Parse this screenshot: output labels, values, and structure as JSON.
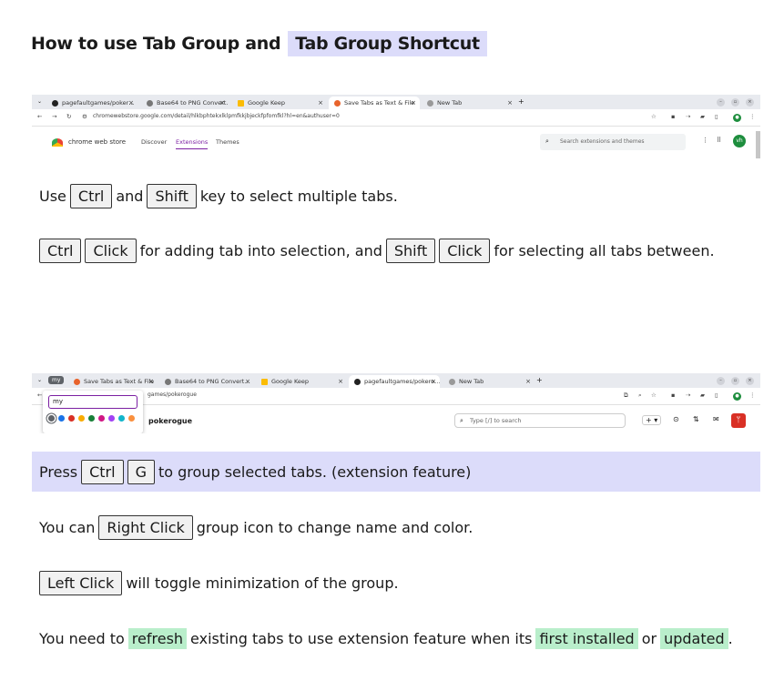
{
  "title": {
    "prefix": "How to use Tab Group and",
    "highlight": "Tab Group Shortcut"
  },
  "shot1": {
    "tabs": [
      "pagefaultgames/poker…",
      "Base64 to PNG Convert…",
      "Google Keep",
      "Save Tabs as Text & File",
      "New Tab"
    ],
    "url": "chromewebstore.google.com/detail/hlkbphtekxlklpmfkkjbjeckfpfomfkl?hl=en&authuser=0",
    "store_name": "chrome web store",
    "nav": [
      "Discover",
      "Extensions",
      "Themes"
    ],
    "search_placeholder": "Search extensions and themes",
    "avatar": "vh"
  },
  "line1": {
    "a": "Use",
    "k1": "Ctrl",
    "b": "and",
    "k2": "Shift",
    "c": "key to select multiple tabs."
  },
  "line2": {
    "k1": "Ctrl",
    "k2": "Click",
    "a": "for adding tab into selection, and",
    "k3": "Shift",
    "k4": "Click",
    "b": "for selecting all tabs between."
  },
  "shot2": {
    "group_label": "my",
    "tabs": [
      "Save Tabs as Text & File",
      "Base64 to PNG Convert…",
      "Google Keep",
      "pagefaultgames/pokero…",
      "New Tab"
    ],
    "name_input": "my",
    "url_fragment": "games/pokerogue",
    "repo_name": "pokerogue",
    "search_text": "Type [/] to search",
    "group_colors": [
      "#5f6368",
      "#1a73e8",
      "#d93025",
      "#f9ab00",
      "#188038",
      "#d01884",
      "#a142f4",
      "#12b5cb",
      "#fa903e"
    ]
  },
  "line3": {
    "a": "Press",
    "k1": "Ctrl",
    "k2": "G",
    "b": "to group selected tabs. (extension feature)"
  },
  "line4": {
    "a": "You can",
    "k1": "Right Click",
    "b": "group icon to change name and color."
  },
  "line5": {
    "k1": "Left Click",
    "a": "will toggle minimization of the group."
  },
  "line6": {
    "a": "You need to",
    "g1": "refresh",
    "b": "existing tabs to use extension feature when its",
    "g2": "first installed",
    "c": "or",
    "g3": "updated",
    "d": "."
  }
}
